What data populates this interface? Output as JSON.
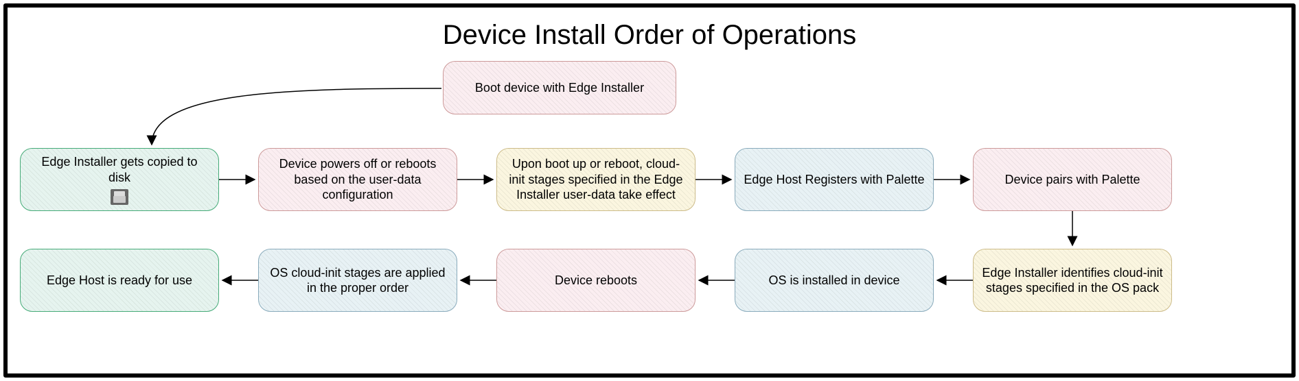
{
  "title": "Device Install Order of Operations",
  "nodes": {
    "boot": "Boot device with Edge Installer",
    "copied": "Edge Installer gets copied to disk",
    "poweroff": "Device powers off or reboots based on the user-data configuration",
    "cloudinit_edge": "Upon boot up or reboot, cloud-init stages specified in the Edge Installer user-data take effect",
    "register": "Edge Host Registers with Palette",
    "pair": "Device pairs with Palette",
    "identify_os": "Edge Installer identifies cloud-init stages specified in the OS pack",
    "os_install": "OS is installed in device",
    "reboot": "Device reboots",
    "os_cloudinit": "OS cloud-init stages are applied in the proper order",
    "ready": "Edge Host is ready for use"
  }
}
